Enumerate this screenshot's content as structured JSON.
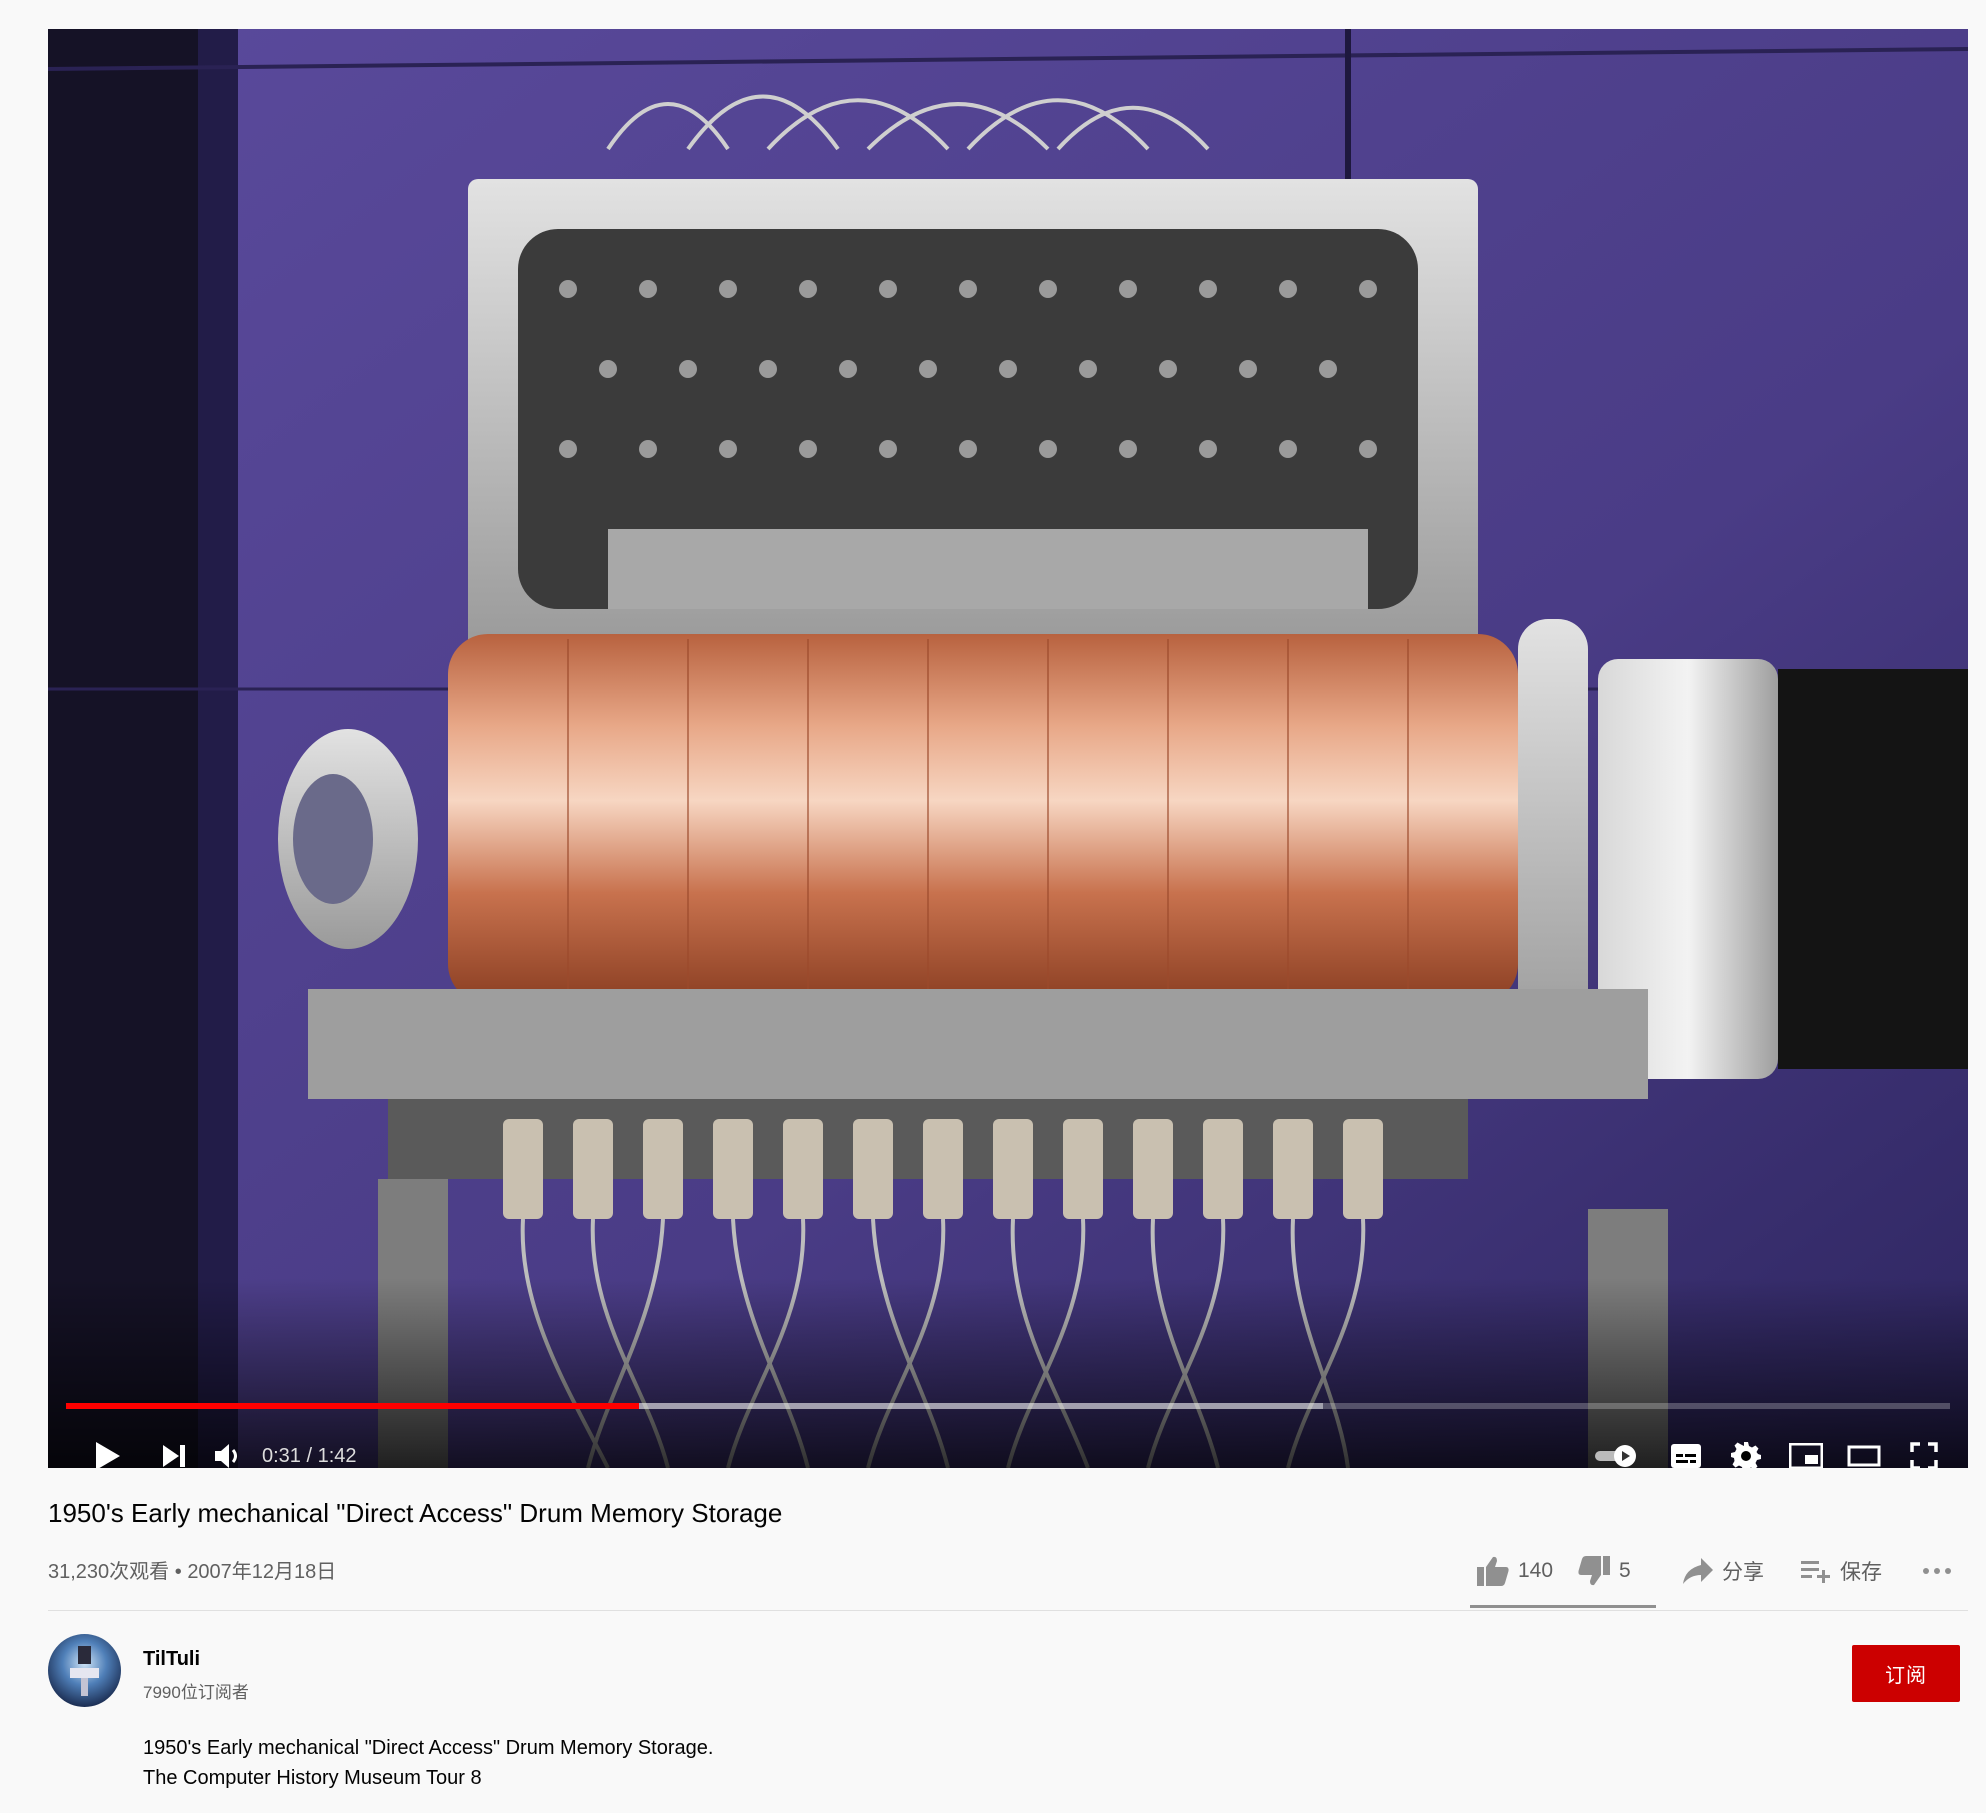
{
  "video": {
    "title": "1950's Early mechanical \"Direct Access\" Drum Memory Storage",
    "views": "31,230次观看",
    "separator": "•",
    "date": "2007年12月18日",
    "description_lines": [
      "1950's Early mechanical \"Direct Access\" Drum Memory Storage.",
      "The Computer History Museum Tour 8"
    ]
  },
  "player": {
    "time_display": "0:31 / 1:42",
    "played_fraction": 0.304,
    "buffered_fraction": 0.667,
    "controls": {
      "play_icon": "play-icon",
      "next_icon": "next-icon",
      "volume_icon": "volume-icon",
      "autoplay_icon": "autoplay-toggle-icon",
      "subtitles_icon": "subtitles-icon",
      "settings_icon": "gear-icon",
      "miniplayer_icon": "miniplayer-icon",
      "theater_icon": "theater-icon",
      "fullscreen_icon": "fullscreen-icon"
    }
  },
  "actions": {
    "like_count": "140",
    "dislike_count": "5",
    "share_label": "分享",
    "save_label": "保存",
    "like_ratio": 0.966
  },
  "channel": {
    "name": "TilTuli",
    "subscribers": "7990位订阅者",
    "subscribe_label": "订阅"
  },
  "colors": {
    "progress_played": "#ff0000",
    "subscribe_bg": "#cc0000",
    "page_bg": "#f9f9f9"
  }
}
